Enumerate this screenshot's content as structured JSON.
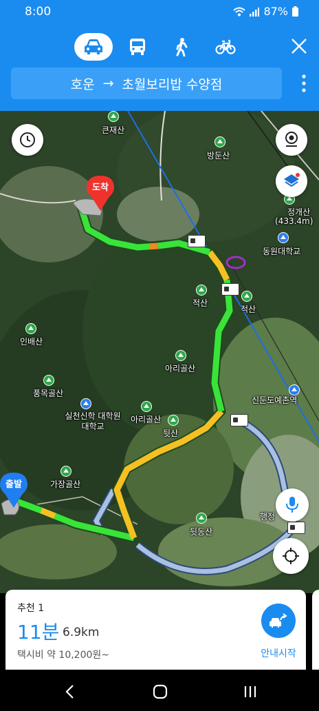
{
  "status": {
    "time": "8:00",
    "battery": "87%"
  },
  "transport_modes": [
    "car",
    "bus",
    "walk",
    "bike"
  ],
  "route": {
    "origin": "호운",
    "arrow": "→",
    "destination": "초월보리밥 수양점"
  },
  "map": {
    "arrival_label": "도착",
    "departure_label": "출발",
    "places": {
      "keunjaesan": "큰재산",
      "bangdunsan": "방둔산",
      "jeonggaesan": "정개산",
      "jeonggaesan_height": "(433.4m)",
      "dongwon_univ": "동원대학교",
      "jeoksan1": "적산",
      "jeoksan2": "적산",
      "inbaesan": "인배산",
      "arigolsan1": "아리골산",
      "pungmokgolsan": "풍목골산",
      "silcheon_univ": "실천신학 대학원대학교",
      "arigolsan2": "아리골산",
      "dwitsan": "뒷산",
      "sindundoyechon": "신둔도예촌역",
      "gajanggolsan": "가장골산",
      "haengjeong": "행정",
      "dwitdongsan": "뒷동산"
    }
  },
  "summary": {
    "rank_label": "추천 1",
    "duration": "11분",
    "distance": "6.9km",
    "taxi_fare": "택시비 약 10,200원~",
    "start_label": "안내시작"
  },
  "colors": {
    "accent": "#1a8cf0",
    "route_fast": "#3ae33a",
    "route_slow": "#f5c023",
    "route_alt": "#a9c0e0",
    "pin_red": "#f0322d",
    "pin_blue": "#1f7ef0"
  }
}
